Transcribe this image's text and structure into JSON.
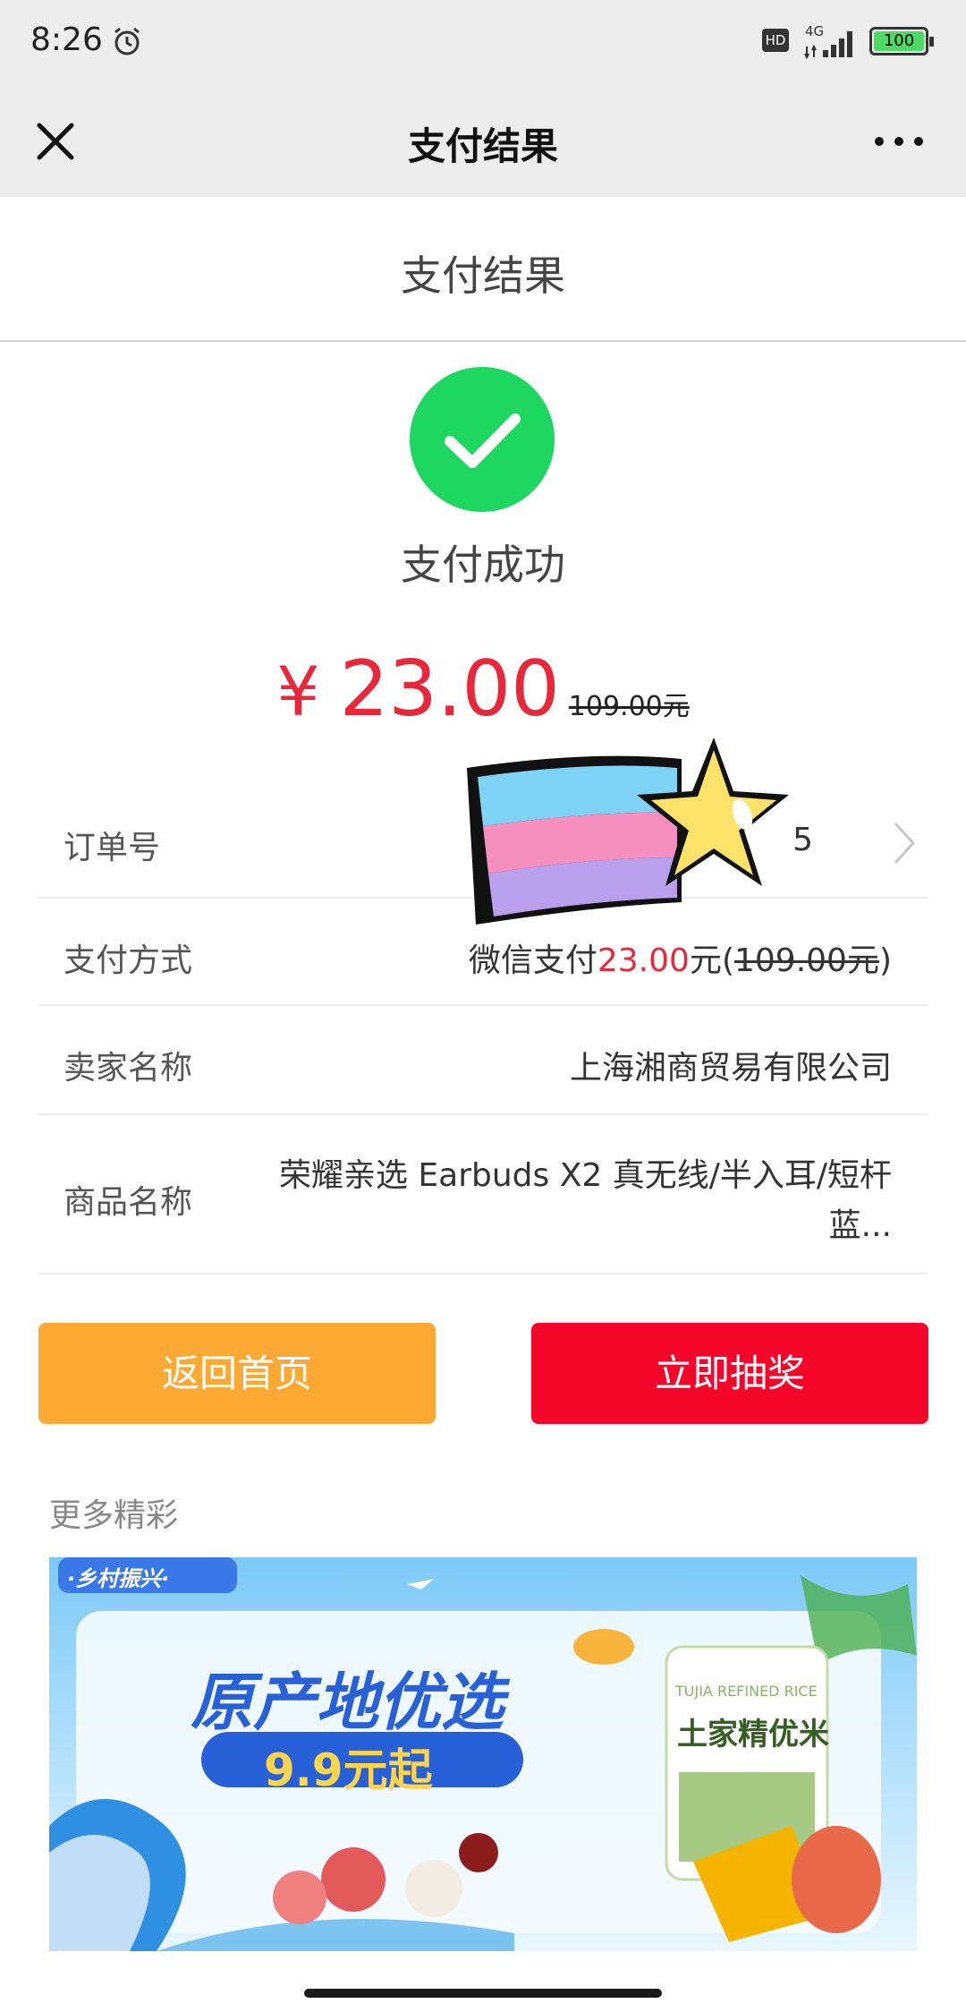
{
  "status_bar": {
    "time": "8:26",
    "hd": "HD",
    "network": "4G",
    "battery": "100"
  },
  "nav": {
    "title": "支付结果"
  },
  "page": {
    "heading": "支付结果",
    "success_text": "支付成功",
    "currency": "¥",
    "amount": "23.00",
    "original_price": "109.00元"
  },
  "details": {
    "order_label": "订单号",
    "order_tail": "5",
    "pay_method_label": "支付方式",
    "pay_method_prefix": "微信支付",
    "pay_amount": "23.00",
    "pay_unit": "元(",
    "pay_original": "109.00元",
    "pay_close": ")",
    "seller_label": "卖家名称",
    "seller": "上海湘商贸易有限公司",
    "product_label": "商品名称",
    "product": "荣耀亲选 Earbuds X2 真无线/半入耳/短杆蓝..."
  },
  "buttons": {
    "home": "返回首页",
    "lottery": "立即抽奖"
  },
  "more": {
    "heading": "更多精彩"
  },
  "banner": {
    "tag": "·乡村振兴·",
    "headline": "原产地优选",
    "price_line": "9.9元起",
    "product_en": "TUJIA REFINED RICE",
    "product_cn": "土家精优米"
  },
  "colors": {
    "accent_red": "#e8273b",
    "success_green": "#1ed760",
    "home_button": "#fba933",
    "lottery_button": "#f3062a"
  }
}
